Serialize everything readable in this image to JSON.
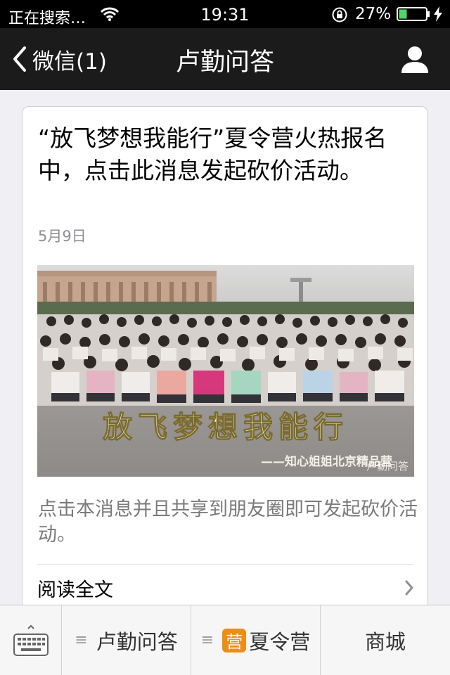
{
  "status": {
    "carrier": "正在搜索…",
    "time": "19:31",
    "battery": "27%"
  },
  "nav": {
    "back_label": "微信(1)",
    "title": "卢勤问答",
    "profile_icon": "person-icon"
  },
  "article": {
    "title": "“放飞梦想我能行”夏令营火热报名中，点击此消息发起砍价活动。",
    "date": "5月9日",
    "cover_banner": "放飞梦想我能行",
    "cover_caption": "——知心姐姐北京精品营",
    "cover_watermark": "卢勤问答",
    "digest": "点击本消息并且共享到朋友圈即可发起砍价活动。",
    "read_more": "阅读全文"
  },
  "bottom_menu": {
    "keyboard_icon": "keyboard-icon",
    "items": [
      {
        "label": "卢勤问答",
        "icon": "menu-lines-icon"
      },
      {
        "label": "夏令营",
        "icon": "menu-lines-icon",
        "tag": "营"
      },
      {
        "label": "商城"
      }
    ]
  },
  "colors": {
    "navbar": "#1b1b1b",
    "battery_fill": "#4cd964",
    "tag": "#f08c16"
  }
}
